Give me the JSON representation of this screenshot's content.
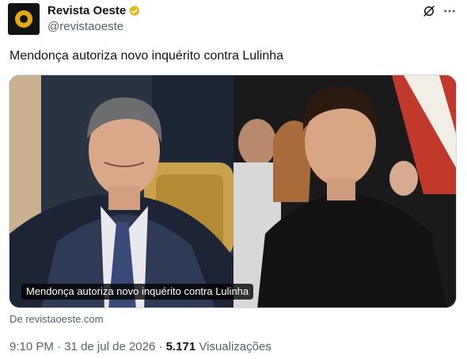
{
  "author": {
    "name": "Revista Oeste",
    "handle": "@revistaoeste"
  },
  "tweet": {
    "text": "Mendonça autoriza novo inquérito contra Lulinha"
  },
  "card": {
    "headline": "Mendonça autoriza novo inquérito contra Lulinha",
    "source": "De revistaoeste.com"
  },
  "meta": {
    "time": "9:10 PM",
    "separator": "·",
    "date": "31 de jul de 2026",
    "views_count": "5.171",
    "views_label": "Visualizações"
  },
  "icons": {
    "verified": "verified-gold-badge-icon",
    "grok": "grok-icon",
    "more": "more-options-icon"
  },
  "colors": {
    "text": "#0f1419",
    "secondary": "#536471",
    "verified_gold": "#e2b719",
    "avatar_ring": "#e3a90f"
  }
}
